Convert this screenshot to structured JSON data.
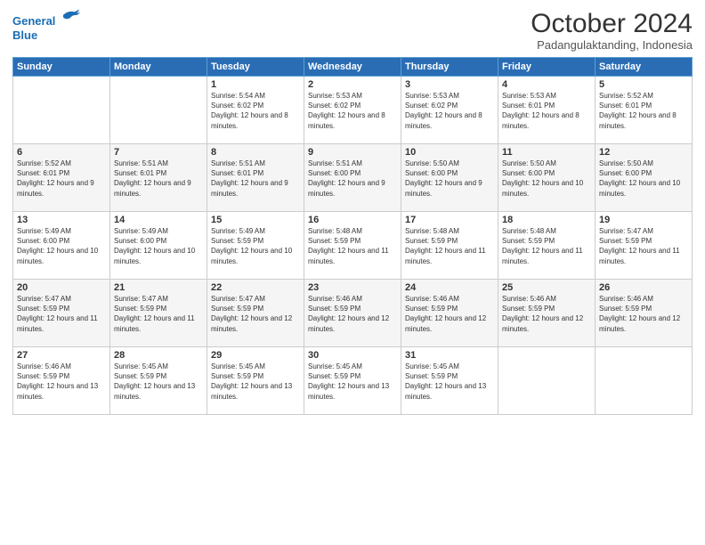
{
  "logo": {
    "line1": "General",
    "line2": "Blue",
    "icon_color": "#1a6eb5"
  },
  "title": "October 2024",
  "location": "Padangulaktanding, Indonesia",
  "weekdays": [
    "Sunday",
    "Monday",
    "Tuesday",
    "Wednesday",
    "Thursday",
    "Friday",
    "Saturday"
  ],
  "weeks": [
    [
      {
        "day": "",
        "sunrise": "",
        "sunset": "",
        "daylight": ""
      },
      {
        "day": "",
        "sunrise": "",
        "sunset": "",
        "daylight": ""
      },
      {
        "day": "1",
        "sunrise": "Sunrise: 5:54 AM",
        "sunset": "Sunset: 6:02 PM",
        "daylight": "Daylight: 12 hours and 8 minutes."
      },
      {
        "day": "2",
        "sunrise": "Sunrise: 5:53 AM",
        "sunset": "Sunset: 6:02 PM",
        "daylight": "Daylight: 12 hours and 8 minutes."
      },
      {
        "day": "3",
        "sunrise": "Sunrise: 5:53 AM",
        "sunset": "Sunset: 6:02 PM",
        "daylight": "Daylight: 12 hours and 8 minutes."
      },
      {
        "day": "4",
        "sunrise": "Sunrise: 5:53 AM",
        "sunset": "Sunset: 6:01 PM",
        "daylight": "Daylight: 12 hours and 8 minutes."
      },
      {
        "day": "5",
        "sunrise": "Sunrise: 5:52 AM",
        "sunset": "Sunset: 6:01 PM",
        "daylight": "Daylight: 12 hours and 8 minutes."
      }
    ],
    [
      {
        "day": "6",
        "sunrise": "Sunrise: 5:52 AM",
        "sunset": "Sunset: 6:01 PM",
        "daylight": "Daylight: 12 hours and 9 minutes."
      },
      {
        "day": "7",
        "sunrise": "Sunrise: 5:51 AM",
        "sunset": "Sunset: 6:01 PM",
        "daylight": "Daylight: 12 hours and 9 minutes."
      },
      {
        "day": "8",
        "sunrise": "Sunrise: 5:51 AM",
        "sunset": "Sunset: 6:01 PM",
        "daylight": "Daylight: 12 hours and 9 minutes."
      },
      {
        "day": "9",
        "sunrise": "Sunrise: 5:51 AM",
        "sunset": "Sunset: 6:00 PM",
        "daylight": "Daylight: 12 hours and 9 minutes."
      },
      {
        "day": "10",
        "sunrise": "Sunrise: 5:50 AM",
        "sunset": "Sunset: 6:00 PM",
        "daylight": "Daylight: 12 hours and 9 minutes."
      },
      {
        "day": "11",
        "sunrise": "Sunrise: 5:50 AM",
        "sunset": "Sunset: 6:00 PM",
        "daylight": "Daylight: 12 hours and 10 minutes."
      },
      {
        "day": "12",
        "sunrise": "Sunrise: 5:50 AM",
        "sunset": "Sunset: 6:00 PM",
        "daylight": "Daylight: 12 hours and 10 minutes."
      }
    ],
    [
      {
        "day": "13",
        "sunrise": "Sunrise: 5:49 AM",
        "sunset": "Sunset: 6:00 PM",
        "daylight": "Daylight: 12 hours and 10 minutes."
      },
      {
        "day": "14",
        "sunrise": "Sunrise: 5:49 AM",
        "sunset": "Sunset: 6:00 PM",
        "daylight": "Daylight: 12 hours and 10 minutes."
      },
      {
        "day": "15",
        "sunrise": "Sunrise: 5:49 AM",
        "sunset": "Sunset: 5:59 PM",
        "daylight": "Daylight: 12 hours and 10 minutes."
      },
      {
        "day": "16",
        "sunrise": "Sunrise: 5:48 AM",
        "sunset": "Sunset: 5:59 PM",
        "daylight": "Daylight: 12 hours and 11 minutes."
      },
      {
        "day": "17",
        "sunrise": "Sunrise: 5:48 AM",
        "sunset": "Sunset: 5:59 PM",
        "daylight": "Daylight: 12 hours and 11 minutes."
      },
      {
        "day": "18",
        "sunrise": "Sunrise: 5:48 AM",
        "sunset": "Sunset: 5:59 PM",
        "daylight": "Daylight: 12 hours and 11 minutes."
      },
      {
        "day": "19",
        "sunrise": "Sunrise: 5:47 AM",
        "sunset": "Sunset: 5:59 PM",
        "daylight": "Daylight: 12 hours and 11 minutes."
      }
    ],
    [
      {
        "day": "20",
        "sunrise": "Sunrise: 5:47 AM",
        "sunset": "Sunset: 5:59 PM",
        "daylight": "Daylight: 12 hours and 11 minutes."
      },
      {
        "day": "21",
        "sunrise": "Sunrise: 5:47 AM",
        "sunset": "Sunset: 5:59 PM",
        "daylight": "Daylight: 12 hours and 11 minutes."
      },
      {
        "day": "22",
        "sunrise": "Sunrise: 5:47 AM",
        "sunset": "Sunset: 5:59 PM",
        "daylight": "Daylight: 12 hours and 12 minutes."
      },
      {
        "day": "23",
        "sunrise": "Sunrise: 5:46 AM",
        "sunset": "Sunset: 5:59 PM",
        "daylight": "Daylight: 12 hours and 12 minutes."
      },
      {
        "day": "24",
        "sunrise": "Sunrise: 5:46 AM",
        "sunset": "Sunset: 5:59 PM",
        "daylight": "Daylight: 12 hours and 12 minutes."
      },
      {
        "day": "25",
        "sunrise": "Sunrise: 5:46 AM",
        "sunset": "Sunset: 5:59 PM",
        "daylight": "Daylight: 12 hours and 12 minutes."
      },
      {
        "day": "26",
        "sunrise": "Sunrise: 5:46 AM",
        "sunset": "Sunset: 5:59 PM",
        "daylight": "Daylight: 12 hours and 12 minutes."
      }
    ],
    [
      {
        "day": "27",
        "sunrise": "Sunrise: 5:46 AM",
        "sunset": "Sunset: 5:59 PM",
        "daylight": "Daylight: 12 hours and 13 minutes."
      },
      {
        "day": "28",
        "sunrise": "Sunrise: 5:45 AM",
        "sunset": "Sunset: 5:59 PM",
        "daylight": "Daylight: 12 hours and 13 minutes."
      },
      {
        "day": "29",
        "sunrise": "Sunrise: 5:45 AM",
        "sunset": "Sunset: 5:59 PM",
        "daylight": "Daylight: 12 hours and 13 minutes."
      },
      {
        "day": "30",
        "sunrise": "Sunrise: 5:45 AM",
        "sunset": "Sunset: 5:59 PM",
        "daylight": "Daylight: 12 hours and 13 minutes."
      },
      {
        "day": "31",
        "sunrise": "Sunrise: 5:45 AM",
        "sunset": "Sunset: 5:59 PM",
        "daylight": "Daylight: 12 hours and 13 minutes."
      },
      {
        "day": "",
        "sunrise": "",
        "sunset": "",
        "daylight": ""
      },
      {
        "day": "",
        "sunrise": "",
        "sunset": "",
        "daylight": ""
      }
    ]
  ]
}
